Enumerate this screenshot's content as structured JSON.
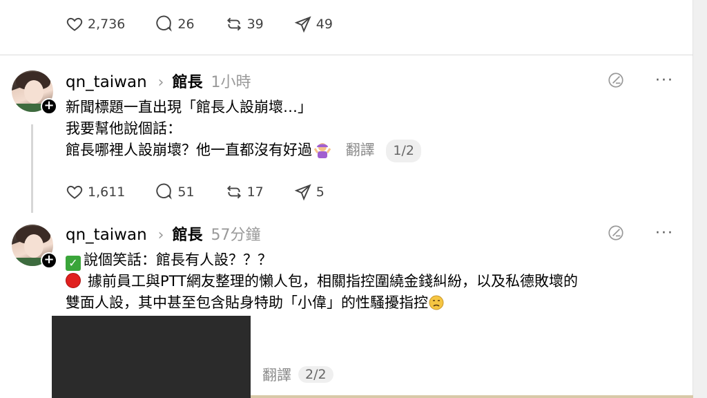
{
  "top_actions": {
    "likes": "2,736",
    "replies": "26",
    "reposts": "39",
    "shares": "49"
  },
  "post1": {
    "username": "qn_taiwan",
    "topic": "館長",
    "time": "1小時",
    "lines": [
      "新聞標題一直出現「館長人設崩壞…」",
      "我要幫他說個話：",
      "館長哪裡人設崩壞？他一直都沒有好過"
    ],
    "translate_label": "翻譯",
    "page": "1/2",
    "actions": {
      "likes": "1,611",
      "replies": "51",
      "reposts": "17",
      "shares": "5"
    }
  },
  "post2": {
    "username": "qn_taiwan",
    "topic": "館長",
    "time": "57分鐘",
    "line1": "說個笑話：館長有人設？？？",
    "line2": "據前員工與PTT網友整理的懶人包，相關指控圍繞金錢糾紛，以及私德敗壞的",
    "line3": "雙面人設，其中甚至包含貼身特助「小偉」的性騷擾指控",
    "translate_label": "翻譯",
    "page": "2/2"
  },
  "icons": [
    "heart-icon",
    "comment-icon",
    "repost-icon",
    "share-icon",
    "ai-label-icon",
    "more-icon",
    "follow-plus-icon"
  ],
  "colors": {
    "text": "#000000",
    "muted": "#999999",
    "divider": "#dbdbdb",
    "pill_bg": "#efefef"
  }
}
